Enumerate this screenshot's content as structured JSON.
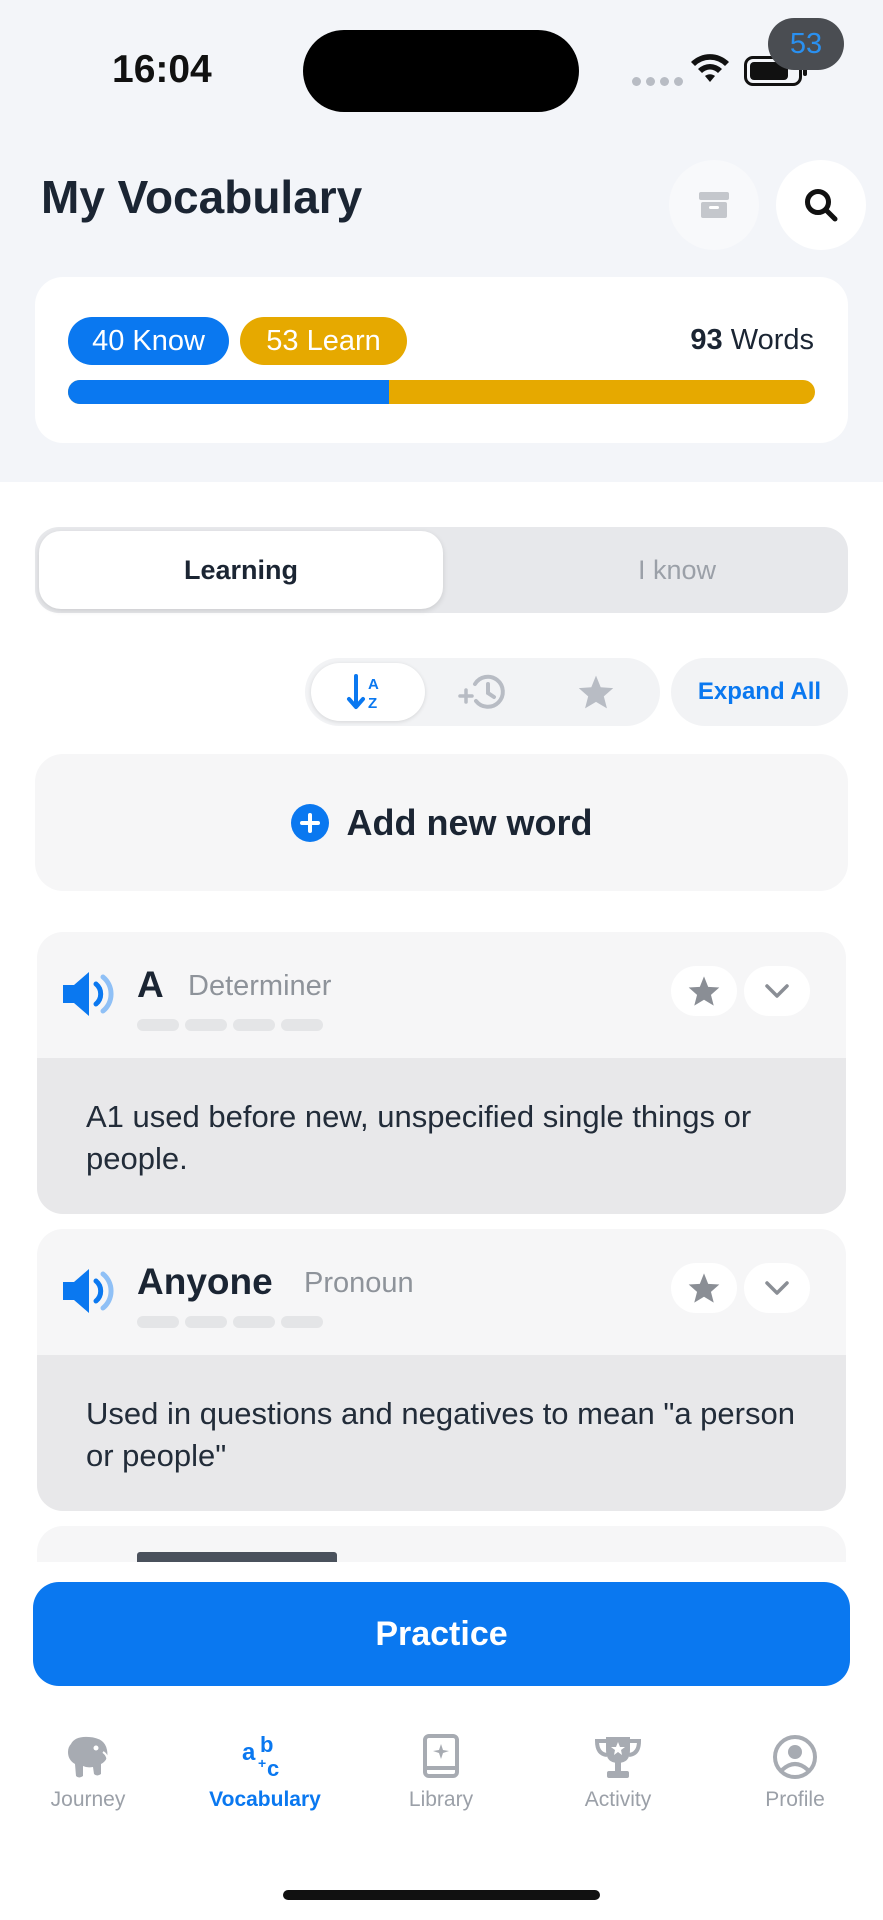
{
  "status_bar": {
    "time": "16:04",
    "notification_count": "53"
  },
  "header": {
    "title": "My Vocabulary"
  },
  "stats": {
    "know_label": "40 Know",
    "learn_label": "53 Learn",
    "words_total": "93",
    "words_unit": "Words",
    "know_fraction": 0.43,
    "know_color": "#0a78f0",
    "learn_color": "#e6a900"
  },
  "segments": {
    "learning": "Learning",
    "i_know": "I know"
  },
  "toolbar": {
    "expand_all": "Expand All"
  },
  "add_word": {
    "label": "Add new word"
  },
  "words": [
    {
      "term": "A",
      "pos": "Determiner",
      "definition": "A1 used before new, unspecified single things or people."
    },
    {
      "term": "Anyone",
      "pos": "Pronoun",
      "definition": "Used in questions and negatives to mean \"a person or people\""
    }
  ],
  "practice": {
    "label": "Practice"
  },
  "tabs": [
    {
      "label": "Journey",
      "icon": "elephant-icon"
    },
    {
      "label": "Vocabulary",
      "icon": "abc-icon"
    },
    {
      "label": "Library",
      "icon": "book-icon"
    },
    {
      "label": "Activity",
      "icon": "trophy-icon"
    },
    {
      "label": "Profile",
      "icon": "profile-icon"
    }
  ],
  "active_tab": "Vocabulary",
  "accent_color": "#0a78f0"
}
